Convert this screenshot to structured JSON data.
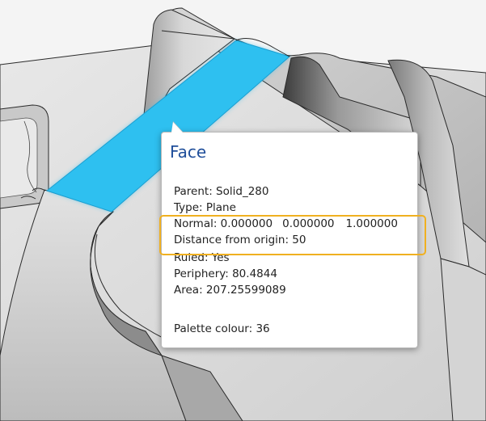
{
  "tooltip": {
    "title": "Face",
    "parent": "Parent: Solid_280",
    "type": "Type: Plane",
    "normal_label": "Normal: 0.000000",
    "normal_y": "0.000000",
    "normal_z": "1.000000",
    "distance": "Distance from origin: 50",
    "ruled": "Ruled: Yes",
    "periphery": "Periphery: 80.4844",
    "area": "Area: 207.25599089",
    "palette": "Palette colour: 36"
  },
  "colors": {
    "selected_face": "#2ec0f0",
    "highlight_border": "#f0b020",
    "title_text": "#1f4e9a"
  }
}
